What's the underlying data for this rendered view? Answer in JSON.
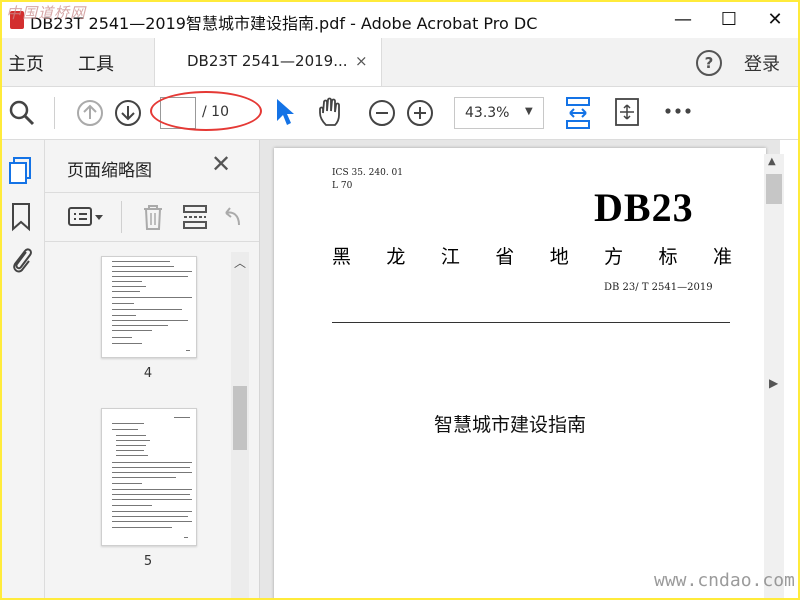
{
  "window": {
    "title": "DB23T 2541—2019智慧城市建设指南.pdf - Adobe Acrobat Pro DC",
    "minimize_glyph": "—",
    "maximize_glyph": "☐",
    "close_glyph": "✕"
  },
  "nav": {
    "home": "主页",
    "tools": "工具",
    "login": "登录",
    "help_glyph": "?"
  },
  "tab": {
    "label": "DB23T 2541—2019...",
    "close_glyph": "×"
  },
  "toolbar": {
    "current_page": "",
    "page_total": "/ 10",
    "zoom": "43.3%",
    "zoom_caret": "▼",
    "icons": [
      "search-icon",
      "page-up-icon",
      "page-down-icon",
      "select-arrow-icon",
      "hand-icon",
      "zoom-out-icon",
      "zoom-in-icon",
      "fit-width-icon",
      "full-screen-icon",
      "more-icon"
    ],
    "annotation_color": "#e53935",
    "accent_color": "#1473e6"
  },
  "sidebar": {
    "rail_icons": [
      "page-thumbnails-icon",
      "bookmark-icon",
      "attachment-icon"
    ],
    "panel_title": "页面缩略图",
    "close_glyph": "✕",
    "tool_icons": [
      "thumbnail-options-icon",
      "delete-icon",
      "extract-icon",
      "undo-icon"
    ],
    "thumbnails": [
      {
        "page": "4"
      },
      {
        "page": "5"
      }
    ]
  },
  "document": {
    "ics": "ICS   35. 240. 01",
    "ccs": "L  70",
    "code": "DB23",
    "standard_chars": [
      "黑",
      "龙",
      "江",
      "省",
      "地",
      "方",
      "标",
      "准"
    ],
    "number": "DB 23/  T  2541—2019",
    "title": "智慧城市建设指南"
  },
  "watermarks": {
    "top_left": "中国道桥网",
    "bottom_right": "www.cndao.com"
  },
  "collapse_glyphs": {
    "left": "◀",
    "right": "▶",
    "up": "▲",
    "up_chevron": "︿"
  }
}
